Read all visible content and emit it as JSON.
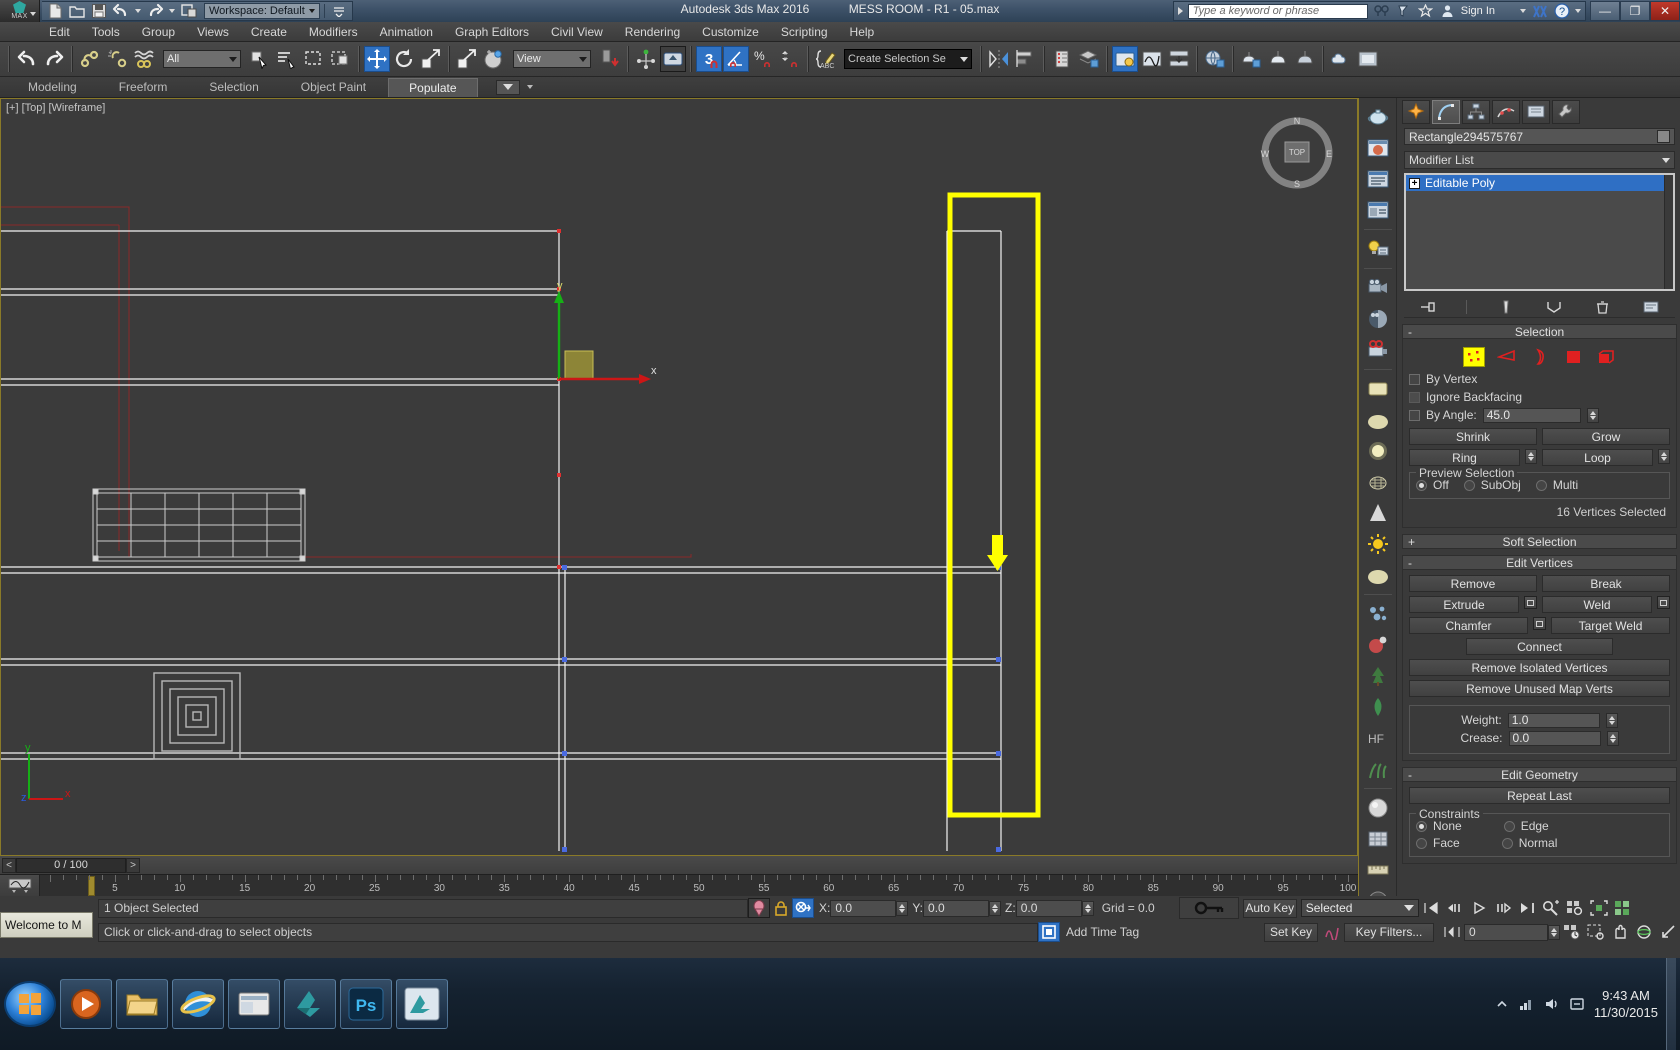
{
  "titlebar": {
    "logo_label": "MAX",
    "workspace": "Workspace: Default",
    "app_title": "Autodesk 3ds Max 2016",
    "file_title": "MESS ROOM - R1 - 05.max",
    "search_placeholder": "Type a keyword or phrase",
    "signin": "Sign In",
    "minimize": "—",
    "restore": "❐",
    "close": "✕",
    "help": "?"
  },
  "menu": {
    "items": [
      "Edit",
      "Tools",
      "Group",
      "Views",
      "Create",
      "Modifiers",
      "Animation",
      "Graph Editors",
      "Civil View",
      "Rendering",
      "Customize",
      "Scripting",
      "Help"
    ]
  },
  "toolbar": {
    "selection_filter": "All",
    "reference_coord": "View",
    "named_selection_set": "Create Selection Se",
    "snap_toggle_label": "3"
  },
  "ribbon": {
    "tabs": [
      "Modeling",
      "Freeform",
      "Selection",
      "Object Paint",
      "Populate"
    ],
    "active": "Populate"
  },
  "viewport": {
    "label": "[+] [Top] [Wireframe]",
    "axis_x": "x",
    "axis_y": "y",
    "axis_z": "z",
    "viewcube_n": "N",
    "viewcube_s": "S",
    "viewcube_e": "E",
    "viewcube_w": "W",
    "viewcube_face": "TOP"
  },
  "timeslider": {
    "prev": "<",
    "next": ">",
    "frame_display": "0 / 100",
    "ruler_labels": [
      "5",
      "10",
      "15",
      "20",
      "25",
      "30",
      "35",
      "40",
      "45",
      "50",
      "55",
      "60",
      "65",
      "70",
      "75",
      "80",
      "85",
      "90",
      "95",
      "100"
    ]
  },
  "command_panel": {
    "tabs": [
      "create-tab",
      "modify-tab",
      "hierarchy-tab",
      "motion-tab",
      "display-tab",
      "utilities-tab"
    ],
    "active_tab_index": 1,
    "object_name": "Rectangle294575767",
    "modifier_list_label": "Modifier List",
    "stack": [
      {
        "label": "Editable Poly",
        "expand": "+"
      }
    ],
    "selection": {
      "title": "Selection",
      "collapse": "-",
      "sub_object_levels": [
        "vertex",
        "edge",
        "border",
        "polygon",
        "element"
      ],
      "active_sub_object": "vertex",
      "by_vertex": "By Vertex",
      "ignore_backfacing": "Ignore Backfacing",
      "by_angle": "By Angle:",
      "by_angle_value": "45.0",
      "shrink": "Shrink",
      "grow": "Grow",
      "ring": "Ring",
      "loop": "Loop",
      "preview_selection": "Preview Selection",
      "preview_off": "Off",
      "preview_subobj": "SubObj",
      "preview_multi": "Multi",
      "status": "16 Vertices Selected"
    },
    "soft_selection": {
      "title": "Soft Selection",
      "expand": "+"
    },
    "edit_vertices": {
      "title": "Edit Vertices",
      "collapse": "-",
      "remove": "Remove",
      "break": "Break",
      "extrude": "Extrude",
      "weld": "Weld",
      "chamfer": "Chamfer",
      "target_weld": "Target Weld",
      "connect": "Connect",
      "remove_isolated": "Remove Isolated Vertices",
      "remove_unused_map": "Remove Unused Map Verts",
      "weight_label": "Weight:",
      "weight_value": "1.0",
      "crease_label": "Crease:",
      "crease_value": "0.0"
    },
    "edit_geometry": {
      "title": "Edit Geometry",
      "collapse": "-",
      "repeat_last": "Repeat Last",
      "constraints": "Constraints",
      "none": "None",
      "edge": "Edge",
      "face": "Face",
      "normal": "Normal"
    }
  },
  "statusbar": {
    "maxscript_listener": "Welcome to M",
    "selection_status": "1 Object Selected",
    "prompt": "Click or click-and-drag to select objects",
    "x_label": "X:",
    "x_value": "0.0",
    "y_label": "Y:",
    "y_value": "0.0",
    "z_label": "Z:",
    "z_value": "0.0",
    "grid": "Grid = 0.0",
    "add_time_tag": "Add Time Tag",
    "auto_key": "Auto Key",
    "set_key": "Set Key",
    "key_mode": "Selected",
    "key_filters": "Key Filters...",
    "frame_value": "0"
  },
  "taskbar": {
    "apps": [
      "start-orb",
      "media-player",
      "explorer-folder",
      "internet-explorer",
      "file-manager",
      "3ds-max-switcher",
      "photoshop",
      "max-render"
    ],
    "clock_time": "9:43 AM",
    "clock_date": "11/30/2015"
  },
  "colors": {
    "accent_blue": "#2f72c4",
    "highlight_yellow": "#ffff00",
    "viewport_bg": "#3b3b3b",
    "panel_bg": "#3a3a3a",
    "selection_red": "#e02020",
    "axis_green": "#00b000",
    "axis_red": "#cc0000"
  }
}
